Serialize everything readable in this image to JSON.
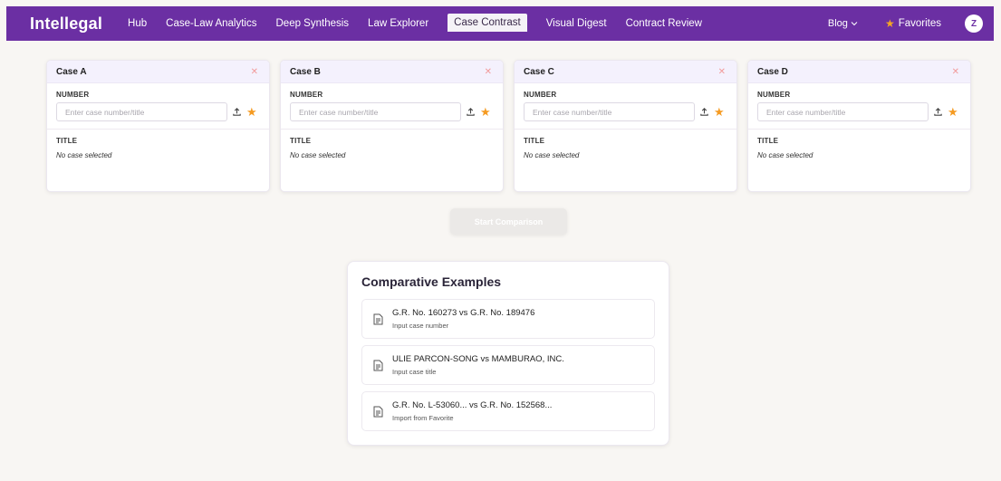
{
  "nav": {
    "brand": "Intellegal",
    "links": [
      "Hub",
      "Case-Law Analytics",
      "Deep Synthesis",
      "Law Explorer",
      "Case Contrast",
      "Visual Digest",
      "Contract Review"
    ],
    "active": "Case Contrast",
    "blog": "Blog",
    "favorites": "Favorites",
    "avatar": "Z",
    "accent": "#6b2fa3"
  },
  "cases": [
    {
      "title": "Case A",
      "number_label": "NUMBER",
      "placeholder": "Enter case number/title",
      "title_label": "TITLE",
      "status": "No case selected"
    },
    {
      "title": "Case B",
      "number_label": "NUMBER",
      "placeholder": "Enter case number/title",
      "title_label": "TITLE",
      "status": "No case selected"
    },
    {
      "title": "Case C",
      "number_label": "NUMBER",
      "placeholder": "Enter case number/title",
      "title_label": "TITLE",
      "status": "No case selected"
    },
    {
      "title": "Case D",
      "number_label": "NUMBER",
      "placeholder": "Enter case number/title",
      "title_label": "TITLE",
      "status": "No case selected"
    }
  ],
  "start_button": "Start Comparison",
  "examples": {
    "title": "Comparative Examples",
    "items": [
      {
        "main": "G.R. No. 160273 vs G.R. No. 189476",
        "sub": "Input case number"
      },
      {
        "main": "ULIE PARCON-SONG vs MAMBURAO, INC.",
        "sub": "Input case title"
      },
      {
        "main": "G.R. No. L-53060... vs G.R. No. 152568...",
        "sub": "Import from Favorite"
      }
    ]
  }
}
